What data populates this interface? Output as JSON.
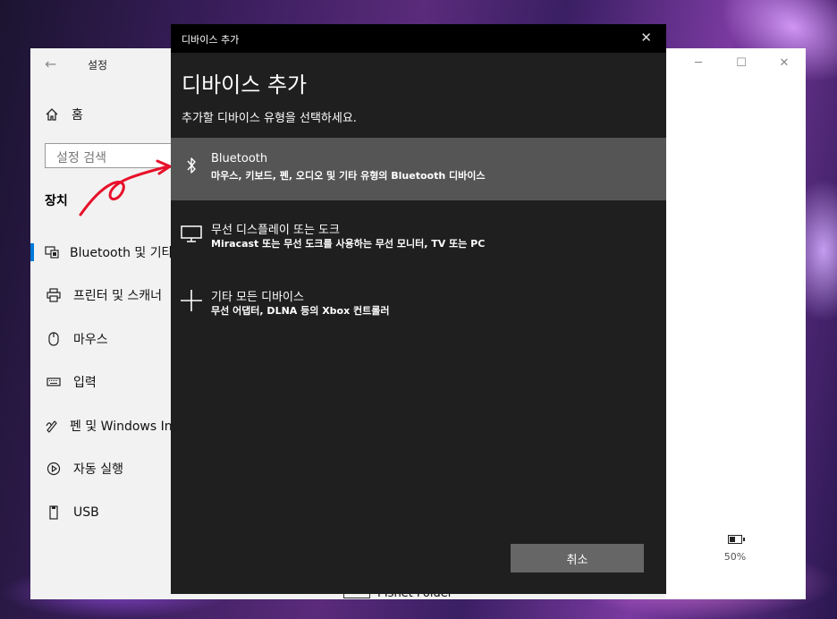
{
  "settings": {
    "title": "설정",
    "home_label": "홈",
    "search_placeholder": "설정 검색",
    "section_title": "장치",
    "nav": [
      {
        "label": "Bluetooth 및 기타 디바이스",
        "icon": "bluetooth-devices-icon"
      },
      {
        "label": "프린터 및 스캐너",
        "icon": "printer-icon"
      },
      {
        "label": "마우스",
        "icon": "mouse-icon"
      },
      {
        "label": "입력",
        "icon": "keyboard-icon"
      },
      {
        "label": "펜 및 Windows Ink",
        "icon": "pen-icon"
      },
      {
        "label": "자동 실행",
        "icon": "autoplay-icon"
      },
      {
        "label": "USB",
        "icon": "usb-icon"
      }
    ],
    "battery": "50%",
    "folder_label": "PIsnet Folder"
  },
  "dialog": {
    "window_title": "디바이스 추가",
    "heading": "디바이스 추가",
    "subtitle": "추가할 디바이스 유형을 선택하세요.",
    "options": [
      {
        "title": "Bluetooth",
        "desc": "마우스, 키보드, 펜, 오디오 및 기타 유형의 Bluetooth 디바이스",
        "icon": "bluetooth-icon"
      },
      {
        "title": "무선 디스플레이 또는 도크",
        "desc": "Miracast 또는 무선 도크를 사용하는 무선 모니터, TV 또는 PC",
        "icon": "monitor-icon"
      },
      {
        "title": "기타 모든 디바이스",
        "desc": "무선 어댑터, DLNA 등의 Xbox 컨트롤러",
        "icon": "plus-icon"
      }
    ],
    "cancel_label": "취소"
  },
  "colors": {
    "accent": "#0078d7",
    "selected_option": "#555555",
    "annotation": "#e8102a"
  }
}
